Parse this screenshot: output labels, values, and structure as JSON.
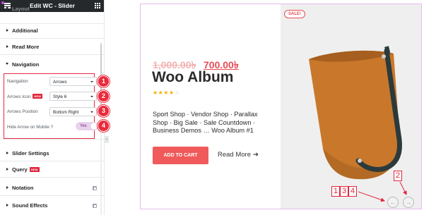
{
  "panel": {
    "title": "Edit WC - Slider",
    "cut_section": "Layout",
    "sections": [
      {
        "label": "Additional",
        "open": false
      },
      {
        "label": "Read More",
        "open": false
      },
      {
        "label": "Navigation",
        "open": true
      },
      {
        "label": "Slider Settings",
        "open": false
      },
      {
        "label": "Query",
        "open": false,
        "badge": "NEW"
      },
      {
        "label": "Notation",
        "open": false
      },
      {
        "label": "Sound Effects",
        "open": false
      }
    ],
    "navigation": {
      "navigation_label": "Navigation",
      "navigation_value": "Arrows",
      "arrows_icon_label": "Arrows Icon",
      "arrows_icon_badge": "NEW",
      "arrows_icon_value": "Style 6",
      "arrows_position_label": "Arrows Position",
      "arrows_position_value": "Bottom Right",
      "hide_arrow_label": "Hide Arrow on Mobile ?",
      "hide_arrow_value": "Yes"
    },
    "markers": [
      "1",
      "2",
      "3",
      "4"
    ]
  },
  "preview": {
    "sale_badge": "SALE!",
    "price_old": "1,000.00৳",
    "price_new": "700.00৳",
    "title": "Woo Album",
    "rating": 4,
    "rating_max": 5,
    "description": "Sport Shop · Vendor Shop · Parallax Shop · Big Sale · Sale Countdown · Business Demos … Woo Album #1",
    "add_to_cart": "ADD TO CART",
    "read_more": "Read More",
    "prev_arrow": "←",
    "next_arrow": "→",
    "annotation_top": "2",
    "annotation_left": [
      "1",
      "3",
      "4"
    ]
  },
  "colors": {
    "accent": "#e0263c",
    "button": "#f05a5a",
    "price": "#e84c55",
    "bag": "#c9782b",
    "strap": "#2b3a3c",
    "toggle": "#e9d2ec"
  }
}
